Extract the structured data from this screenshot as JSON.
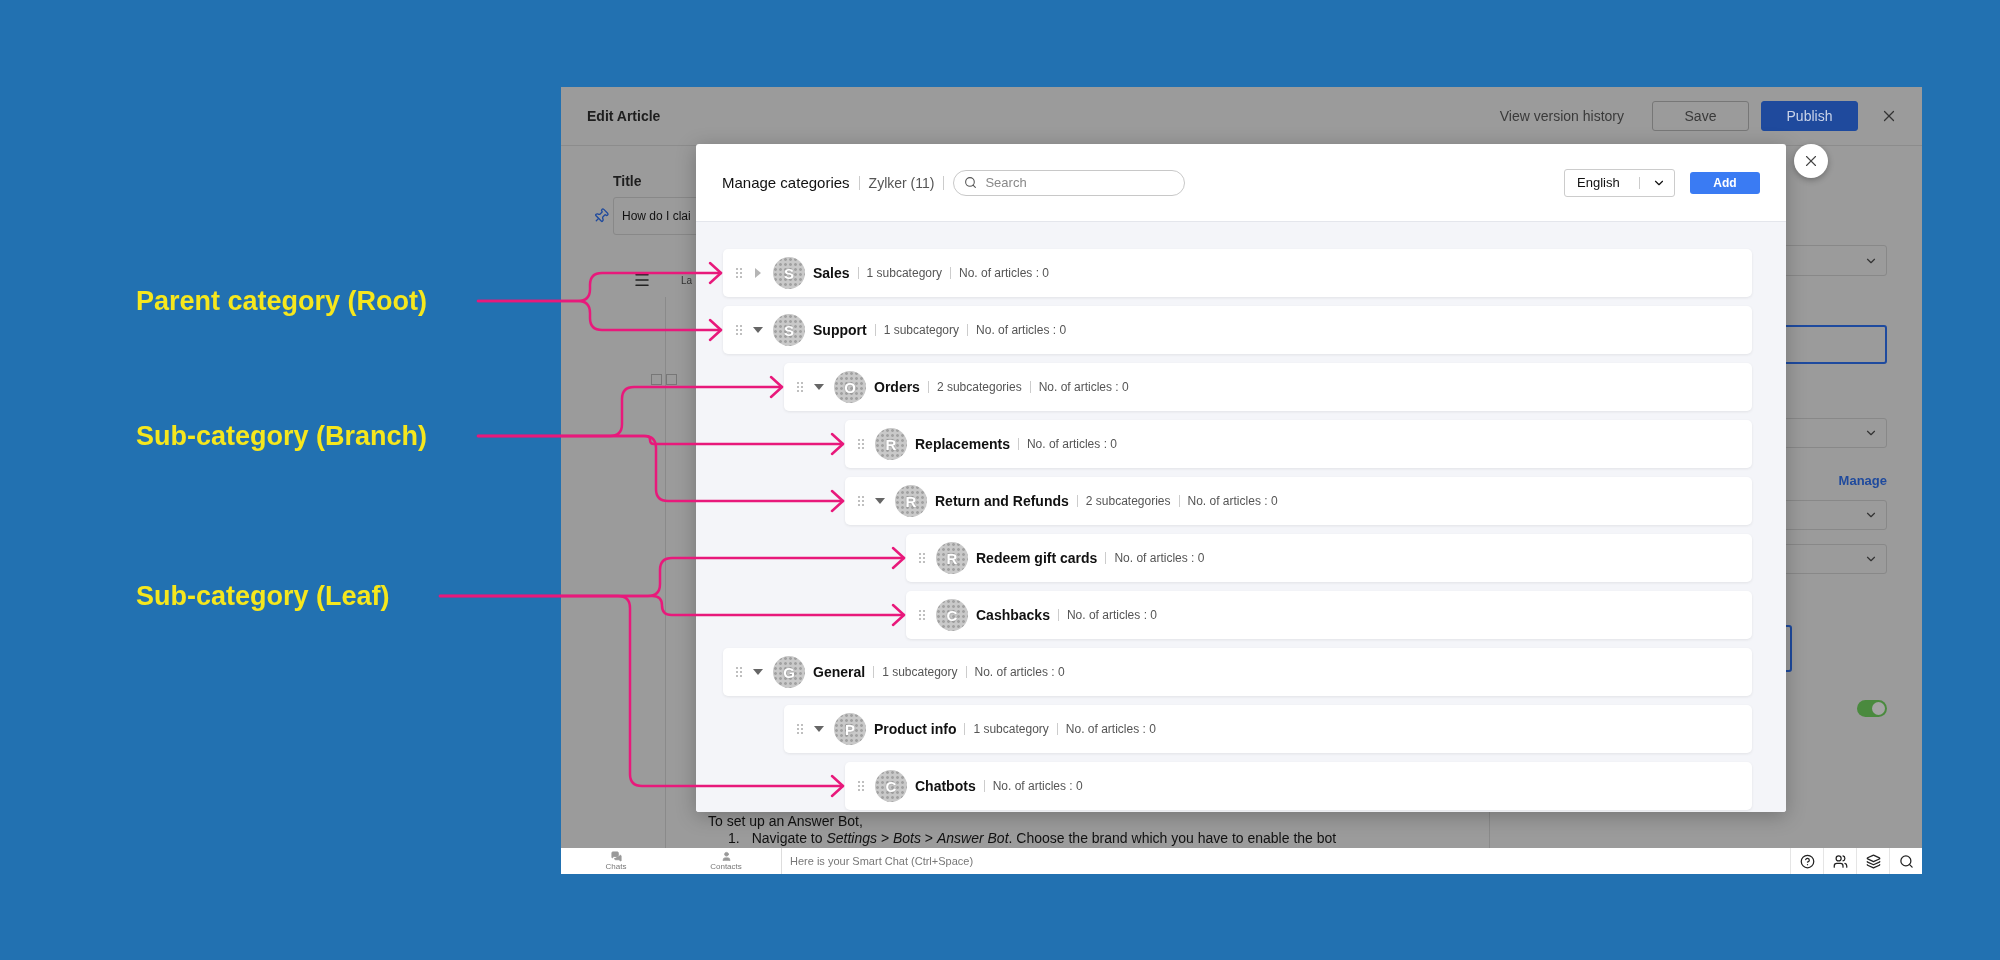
{
  "annotations": [
    {
      "text": "Parent category (Root)"
    },
    {
      "text": "Sub-category (Branch)"
    },
    {
      "text": "Sub-category (Leaf)"
    }
  ],
  "editor": {
    "title": "Edit Article",
    "version_link": "View version history",
    "buttons": [
      {
        "label": "Save",
        "kind": "secondary"
      },
      {
        "label": "Publish",
        "kind": "primary"
      }
    ],
    "title_label": "Title",
    "title_value": "How do I clai",
    "toolbar_text": "La",
    "body_text": "To set up an Answer Bot,",
    "list_items": [
      {
        "number": "1.",
        "text": "Navigate to *Settings* > *Bots* > *Answer Bot*. Choose the brand which you have to enable the bot"
      }
    ],
    "manage_link": "Manage",
    "toggle": {
      "on": true
    }
  },
  "modal": {
    "title": "Manage categories",
    "brand": "Zylker (11)",
    "search": {
      "placeholder": "Search"
    },
    "language": "English",
    "add_button": "Add",
    "categories": [
      {
        "name": "Sales",
        "initial": "S",
        "kind": "branch",
        "expanded": false,
        "subcategories": "1 subcategory",
        "articles": "No. of articles : 0"
      },
      {
        "name": "Support",
        "initial": "S",
        "kind": "branch",
        "expanded": true,
        "subcategories": "1 subcategory",
        "articles": "No. of articles : 0",
        "children": [
          {
            "name": "Orders",
            "initial": "O",
            "kind": "branch",
            "expanded": true,
            "subcategories": "2 subcategories",
            "articles": "No. of articles : 0",
            "children": [
              {
                "name": "Replacements",
                "initial": "R",
                "kind": "leaf",
                "articles": "No. of articles : 0"
              },
              {
                "name": "Return and Refunds",
                "initial": "R",
                "kind": "branch",
                "expanded": true,
                "subcategories": "2 subcategories",
                "articles": "No. of articles : 0",
                "children": [
                  {
                    "name": "Redeem gift cards",
                    "initial": "R",
                    "kind": "leaf",
                    "articles": "No. of articles : 0"
                  },
                  {
                    "name": "Cashbacks",
                    "initial": "C",
                    "kind": "leaf",
                    "articles": "No. of articles : 0"
                  }
                ]
              }
            ]
          }
        ]
      },
      {
        "name": "General",
        "initial": "G",
        "kind": "branch",
        "expanded": true,
        "subcategories": "1 subcategory",
        "articles": "No. of articles : 0",
        "children": [
          {
            "name": "Product info",
            "initial": "P",
            "kind": "branch",
            "expanded": true,
            "subcategories": "1 subcategory",
            "articles": "No. of articles : 0",
            "children": [
              {
                "name": "Chatbots",
                "initial": "C",
                "kind": "leaf",
                "articles": "No. of articles : 0"
              }
            ]
          }
        ]
      }
    ]
  },
  "bottom_bar": {
    "tabs": [
      {
        "label": "Chats",
        "kind": "chats"
      },
      {
        "label": "Contacts",
        "kind": "contacts"
      }
    ],
    "chat": {
      "placeholder": "Here is your Smart Chat (Ctrl+Space)"
    }
  }
}
